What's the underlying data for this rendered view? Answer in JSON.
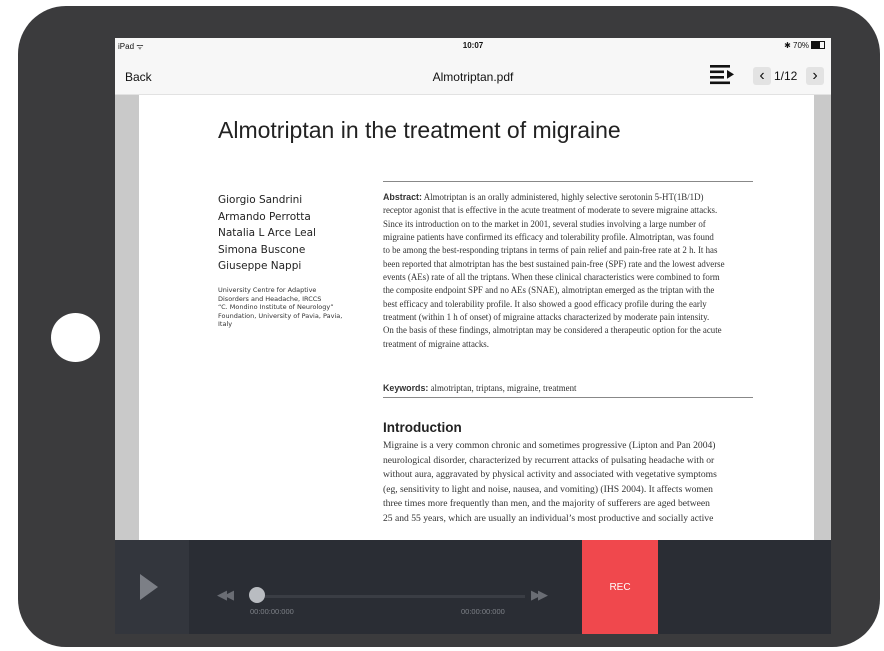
{
  "status_bar": {
    "device": "iPad ᯤ",
    "time": "10:07",
    "battery": "✱ 70%"
  },
  "nav": {
    "back_label": "Back",
    "title": "Almotriptan.pdf",
    "prev_glyph": "‹",
    "next_glyph": "›",
    "page_indicator": "1/12",
    "outline_icon": "list-outline-icon"
  },
  "document": {
    "title": "Almotriptan in the treatment of migraine",
    "authors": [
      "Giorgio Sandrini",
      "Armando Perrotta",
      "Natalia L Arce Leal",
      "Simona Buscone",
      "Giuseppe Nappi"
    ],
    "affiliation": [
      "University Centre for Adaptive",
      "Disorders and Headache, IRCCS",
      "“C. Mondino Institute of Neurology”",
      "Foundation, University of Pavia, Pavia,",
      "Italy"
    ],
    "abstract_label": "Abstract:",
    "abstract_lines": [
      "Almotriptan is an orally administered, highly selective serotonin 5-HT(1B/1D)",
      "receptor agonist that is effective in the acute treatment of moderate to severe migraine attacks.",
      "Since its introduction on to the market in 2001, several studies involving a large number of",
      "migraine patients have confirmed its efficacy and tolerability profile. Almotriptan, was found",
      "to be among the best-responding triptans in terms of pain relief and pain-free rate at 2 h. It has",
      "been reported that almotriptan has the best sustained pain-free (SPF) rate and the lowest adverse",
      "events (AEs) rate of all the triptans. When these clinical characteristics were combined to form",
      "the composite endpoint SPF and no AEs (SNAE), almotriptan emerged as the triptan with the",
      "best efficacy and tolerability profile. It also showed a good efficacy profile during the early",
      "treatment (within 1 h of onset) of migraine attacks characterized by moderate pain intensity.",
      "On the basis of these findings, almotriptan may be considered a therapeutic option for the acute",
      "treatment of migraine attacks."
    ],
    "keywords_label": "Keywords:",
    "keywords": "almotriptan, triptans, migraine, treatment",
    "intro_heading": "Introduction",
    "intro_lines": [
      "Migraine is a very common chronic and sometimes progressive (Lipton and Pan 2004)",
      "neurological disorder, characterized by recurrent attacks of pulsating headache with or",
      "without aura, aggravated by physical activity and associated with vegetative symptoms",
      "(eg, sensitivity to light and noise, nausea, and vomiting) (IHS 2004). It affects women",
      "three times more frequently than men, and the majority of sufferers are aged between",
      "25 and 55 years, which are usually an individual’s most productive and socially active"
    ]
  },
  "player": {
    "skip_back_glyph": "◀◀",
    "skip_fwd_glyph": "▶▶",
    "time_elapsed": "00:00:00:000",
    "time_total": "00:00:00:000",
    "progress": 0,
    "rec_label": "REC",
    "rec_color": "#f0484d"
  }
}
